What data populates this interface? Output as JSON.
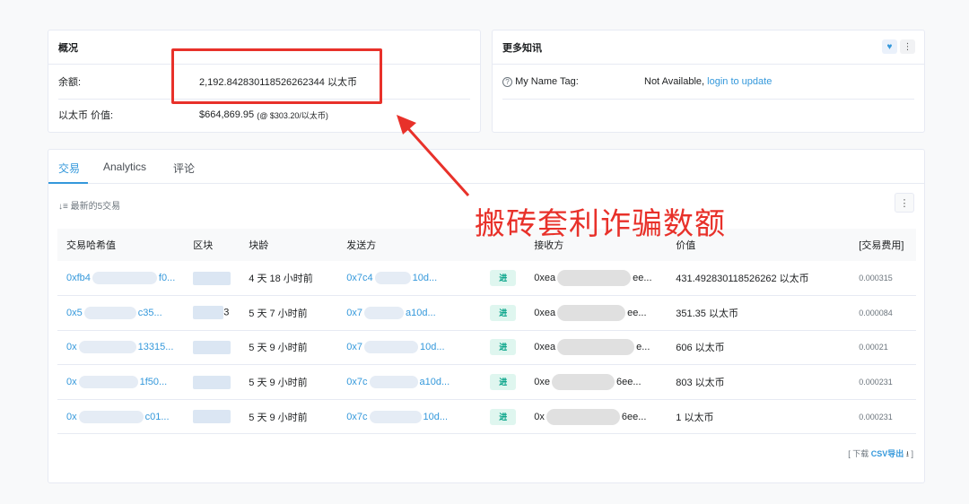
{
  "overview": {
    "title": "概况",
    "balance_label": "余额:",
    "balance_value": "2,192.842830118526262344 以太币",
    "value_label": "以太币 价值:",
    "value_usd": "$664,869.95",
    "value_rate": "(@ $303.20/以太币)"
  },
  "more_info": {
    "title": "更多知讯",
    "name_tag_label": "My Name Tag:",
    "name_tag_value": "Not Available,",
    "name_tag_link": "login to update"
  },
  "tabs": [
    "交易",
    "Analytics",
    "评论"
  ],
  "latest_label": "最新的5交易",
  "table": {
    "headers": [
      "交易哈希值",
      "区块",
      "块龄",
      "发送方",
      "",
      "接收方",
      "价值",
      "[交易费用]"
    ],
    "rows": [
      {
        "hash_a": "0xfb4",
        "hash_b": "f0...",
        "block_b": "",
        "age": "4 天 18 小时前",
        "from_a": "0x7c4",
        "from_b": "10d...",
        "dir": "进",
        "to_a": "0xea",
        "to_b": "ee...",
        "value": "431.492830118526262 以太币",
        "fee": "0.000315"
      },
      {
        "hash_a": "0x5",
        "hash_b": "c35...",
        "block_b": "3",
        "age": "5 天 7 小时前",
        "from_a": "0x7",
        "from_b": "a10d...",
        "dir": "进",
        "to_a": "0xea",
        "to_b": "ee...",
        "value": "351.35 以太币",
        "fee": "0.000084"
      },
      {
        "hash_a": "0x",
        "hash_b": "13315...",
        "block_b": "",
        "age": "5 天 9 小时前",
        "from_a": "0x7",
        "from_b": "10d...",
        "dir": "进",
        "to_a": "0xea",
        "to_b": "e...",
        "value": "606 以太币",
        "fee": "0.00021"
      },
      {
        "hash_a": "0x",
        "hash_b": "1f50...",
        "block_b": "",
        "age": "5 天 9 小时前",
        "from_a": "0x7c",
        "from_b": "a10d...",
        "dir": "进",
        "to_a": "0xe",
        "to_b": "6ee...",
        "value": "803 以太币",
        "fee": "0.000231"
      },
      {
        "hash_a": "0x",
        "hash_b": "c01...",
        "block_b": "",
        "age": "5 天 9 小时前",
        "from_a": "0x7c",
        "from_b": "10d...",
        "dir": "进",
        "to_a": "0x",
        "to_b": "6ee...",
        "value": "1 以太币",
        "fee": "0.000231"
      }
    ]
  },
  "csv": {
    "prefix": "[ 下载",
    "link": "CSV导出",
    "suffix": "]"
  },
  "annotation": {
    "text": "搬砖套利诈骗数额",
    "color": "#e8312a"
  },
  "colors": {
    "link": "#3498db",
    "in_badge_bg": "#dff6ef",
    "in_badge_fg": "#00a186"
  }
}
